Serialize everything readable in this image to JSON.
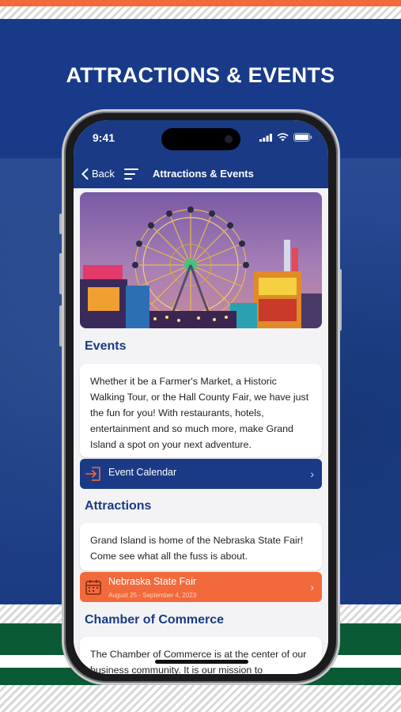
{
  "headline": "ATTRACTIONS & EVENTS",
  "phone": {
    "status_time": "9:41",
    "nav": {
      "back_label": "Back",
      "title": "Attractions & Events"
    }
  },
  "events": {
    "title": "Events",
    "body": "Whether it be a Farmer's Market, a Historic Walking Tour, or the Hall County Fair, we have just the fun for you! With restaurants, hotels, entertainment and so much more, make Grand Island a spot on your next adventure.",
    "action_label": "Event Calendar",
    "action_color": "#1a3a86"
  },
  "attractions": {
    "title": "Attractions",
    "body": "Grand Island is home of the Nebraska State Fair! Come see what all the fuss is about.",
    "action_label": "Nebraska State Fair",
    "action_sub": "August 25 - September 4, 2023",
    "action_color": "#f26a3b"
  },
  "chamber": {
    "title": "Chamber of Commerce",
    "body": "The Chamber of Commerce is at the center of our business community. It is our mission to"
  },
  "hero_image_alt": "ferris-wheel-fair-photo",
  "colors": {
    "brand_blue": "#1a3a86",
    "accent_orange": "#f26a3b",
    "green": "#0b5a36"
  }
}
